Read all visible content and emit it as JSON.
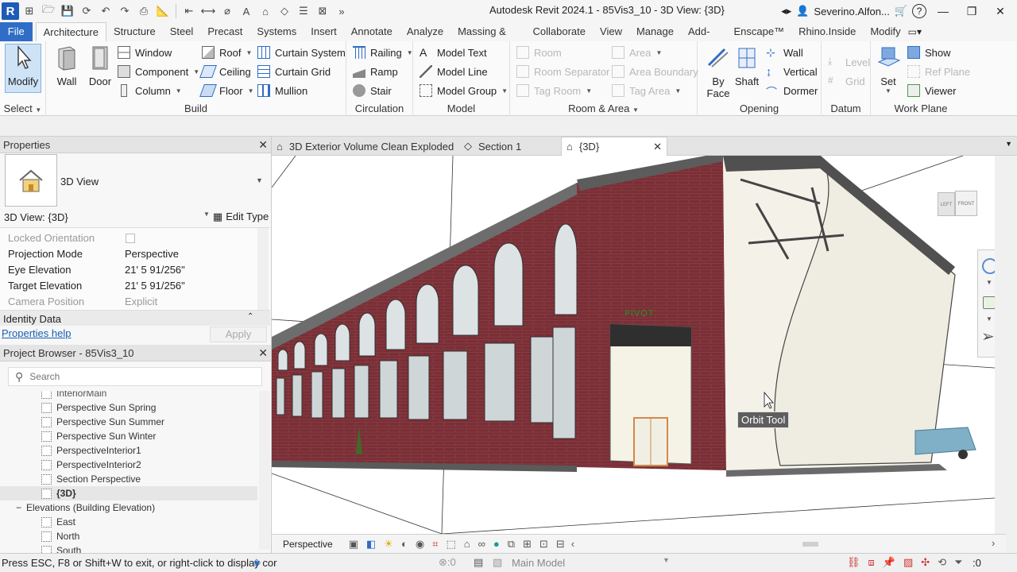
{
  "window": {
    "app_title": "Autodesk Revit 2024.1 - 85Vis3_10 - 3D View: {3D}",
    "user": "Severino.Alfon...",
    "logo": "R"
  },
  "ribbon_tabs": [
    "File",
    "Architecture",
    "Structure",
    "Steel",
    "Precast",
    "Systems",
    "Insert",
    "Annotate",
    "Analyze",
    "Massing & Site",
    "Collaborate",
    "View",
    "Manage",
    "Add-Ins",
    "Enscape™",
    "Rhino.Inside",
    "Modify"
  ],
  "active_tab": "Architecture",
  "ribbon": {
    "select": {
      "modify": "Modify",
      "label": "Select"
    },
    "build": {
      "wall": "Wall",
      "door": "Door",
      "window": "Window",
      "component": "Component",
      "column": "Column",
      "roof": "Roof",
      "ceiling": "Ceiling",
      "floor": "Floor",
      "curtain_system": "Curtain  System",
      "curtain_grid": "Curtain  Grid",
      "mullion": "Mullion",
      "label": "Build"
    },
    "circulation": {
      "railing": "Railing",
      "ramp": "Ramp",
      "stair": "Stair",
      "label": "Circulation"
    },
    "model": {
      "model_text": "Model  Text",
      "model_line": "Model  Line",
      "model_group": "Model  Group",
      "label": "Model"
    },
    "room_area": {
      "room": "Room",
      "room_separator": "Room  Separator",
      "tag_room": "Tag  Room",
      "area": "Area",
      "area_boundary": "Area  Boundary",
      "tag_area": "Tag  Area",
      "label": "Room & Area"
    },
    "opening": {
      "by_face_1": "By",
      "by_face_2": "Face",
      "shaft": "Shaft",
      "wall": "Wall",
      "vertical": "Vertical",
      "dormer": "Dormer",
      "label": "Opening"
    },
    "datum": {
      "level": "Level",
      "grid": "Grid",
      "label": "Datum"
    },
    "work_plane": {
      "set": "Set",
      "show": "Show",
      "ref_plane": "Ref  Plane",
      "viewer": "Viewer",
      "label": "Work Plane"
    }
  },
  "properties": {
    "title": "Properties",
    "type_name": "3D View",
    "instance": "3D View: {3D}",
    "edit_type": "Edit Type",
    "rows": [
      {
        "key": "Locked Orientation",
        "value": ""
      },
      {
        "key": "Projection Mode",
        "value": "Perspective"
      },
      {
        "key": "Eye Elevation",
        "value": "21'  5 91/256\""
      },
      {
        "key": "Target Elevation",
        "value": "21'  5 91/256\""
      },
      {
        "key": "Camera Position",
        "value": "Explicit"
      }
    ],
    "group": "Identity Data",
    "help": "Properties help",
    "apply": "Apply"
  },
  "browser": {
    "title": "Project Browser - 85Vis3_10",
    "search_placeholder": "Search",
    "partial_top": "InteriorMain",
    "items": [
      "Perspective Sun Spring",
      "Perspective Sun Summer",
      "Perspective Sun Winter",
      "PerspectiveInterior1",
      "PerspectiveInterior2",
      "Section Perspective",
      "{3D}"
    ],
    "group": "Elevations (Building Elevation)",
    "elevations": [
      "East",
      "North",
      "South"
    ]
  },
  "doc_tabs": [
    {
      "label": "3D Exterior Volume Clean Exploded"
    },
    {
      "label": "Section 1"
    },
    {
      "label": "{3D}"
    }
  ],
  "viewport": {
    "pivot": "PIVOT",
    "tooltip": "Orbit Tool",
    "viewcube_left": "LEFT",
    "viewcube_front": "FRONT"
  },
  "view_control": {
    "mode": "Perspective"
  },
  "status": {
    "message": "Press ESC, F8 or Shift+W to exit, or right-click to display cor",
    "count": ":0",
    "model": "Main Model",
    "filter_count": ":0"
  },
  "colors": {
    "file_tab": "#2f6dc6",
    "brick": "#7a2e35",
    "logo": "#1e5bb8"
  }
}
